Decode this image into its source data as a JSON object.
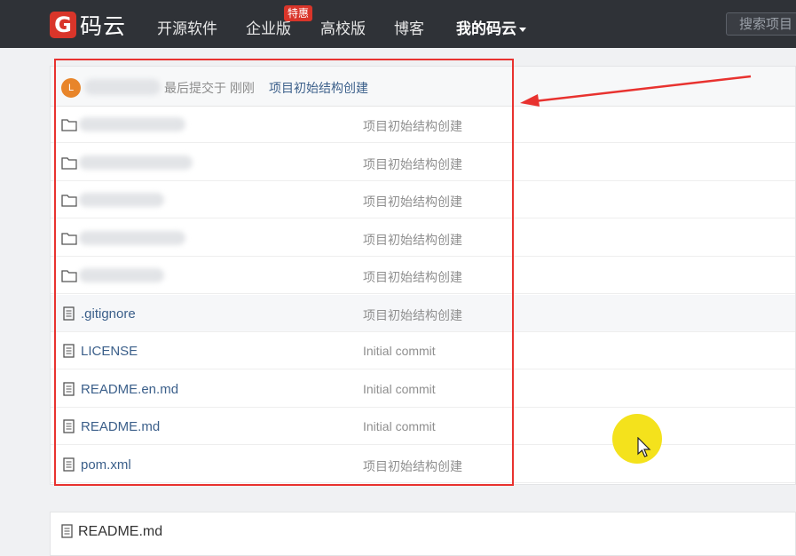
{
  "nav": {
    "logo_glyph": "G",
    "logo_text": "码云",
    "items": [
      "开源软件",
      "企业版",
      "高校版",
      "博客"
    ],
    "badge": "特惠",
    "mine": "我的码云",
    "search_placeholder": "搜索项目"
  },
  "commit": {
    "avatar_letter": "L",
    "meta": "最后提交于 刚刚",
    "message": "项目初始结构创建"
  },
  "files": [
    {
      "type": "folder",
      "name": "",
      "message": "项目初始结构创建"
    },
    {
      "type": "folder",
      "name": "",
      "message": "项目初始结构创建"
    },
    {
      "type": "folder",
      "name": "",
      "message": "项目初始结构创建"
    },
    {
      "type": "folder",
      "name": "",
      "message": "项目初始结构创建"
    },
    {
      "type": "folder",
      "name": "",
      "message": "项目初始结构创建"
    },
    {
      "type": "file",
      "name": ".gitignore",
      "message": "项目初始结构创建"
    },
    {
      "type": "file",
      "name": "LICENSE",
      "message": "Initial commit"
    },
    {
      "type": "file",
      "name": "README.en.md",
      "message": "Initial commit"
    },
    {
      "type": "file",
      "name": "README.md",
      "message": "Initial commit"
    },
    {
      "type": "file",
      "name": "pom.xml",
      "message": "项目初始结构创建"
    }
  ],
  "readme": {
    "title": "README.md"
  },
  "colors": {
    "accent": "#d9352a",
    "annotation": "#e8322f",
    "cursor_highlight": "#f4e21c"
  }
}
